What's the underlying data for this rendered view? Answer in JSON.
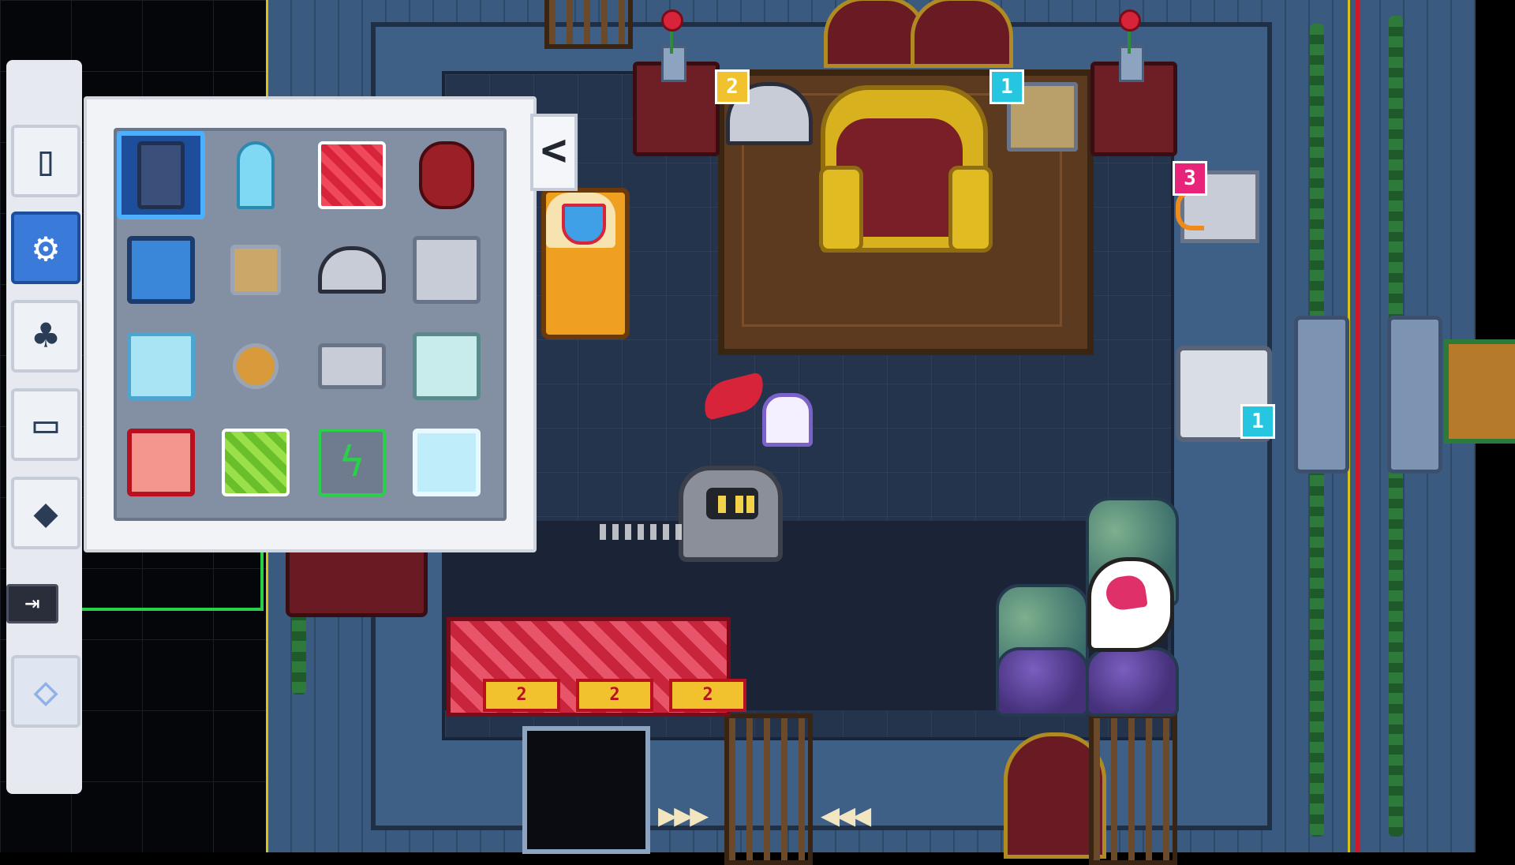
{
  "colors": {
    "accent_blue": "#3a7ad8",
    "selection_border": "#4ab0ff",
    "spike_red": "#c8243c",
    "tag_yellow": "#f2c12e",
    "tag_cyan": "#27c6e0",
    "tag_magenta": "#e8247a",
    "guide_yellow": "#d8c21a",
    "guide_green": "#2ad04a"
  },
  "toolbar": {
    "tools": [
      {
        "icon": "door-icon",
        "glyph": "▯"
      },
      {
        "icon": "gear-icon",
        "glyph": "⚙"
      },
      {
        "icon": "tree-icon",
        "glyph": "♣"
      },
      {
        "icon": "chest-icon",
        "glyph": "▭"
      },
      {
        "icon": "fox-mask-icon",
        "glyph": "◆"
      },
      {
        "icon": "diamond-tile-icon",
        "glyph": "◇"
      }
    ],
    "exit_glyph": "⇥"
  },
  "palette": {
    "collapse_glyph": "<",
    "items": [
      {
        "icon": "robot-statue-icon"
      },
      {
        "icon": "crystal-icon"
      },
      {
        "icon": "red-striped-block-icon"
      },
      {
        "icon": "red-barrel-icon"
      },
      {
        "icon": "blue-gem-block-icon"
      },
      {
        "icon": "pressure-plate-icon"
      },
      {
        "icon": "lever-icon"
      },
      {
        "icon": "keyhole-block-icon"
      },
      {
        "icon": "ice-block-icon"
      },
      {
        "icon": "round-button-icon"
      },
      {
        "icon": "socket-icon"
      },
      {
        "icon": "trophy-block-icon"
      },
      {
        "icon": "red-tile-icon"
      },
      {
        "icon": "green-striped-block-icon"
      },
      {
        "icon": "lightning-tile-icon"
      },
      {
        "icon": "glass-block-icon"
      }
    ]
  },
  "room": {
    "tags": [
      {
        "id": "lever-tag",
        "text": "2"
      },
      {
        "id": "plate-tag",
        "text": "1"
      },
      {
        "id": "socket-tag",
        "text": "3"
      },
      {
        "id": "gate-tag",
        "text": "1"
      }
    ],
    "arrow_blocks": [
      "2",
      "2",
      "2"
    ]
  }
}
